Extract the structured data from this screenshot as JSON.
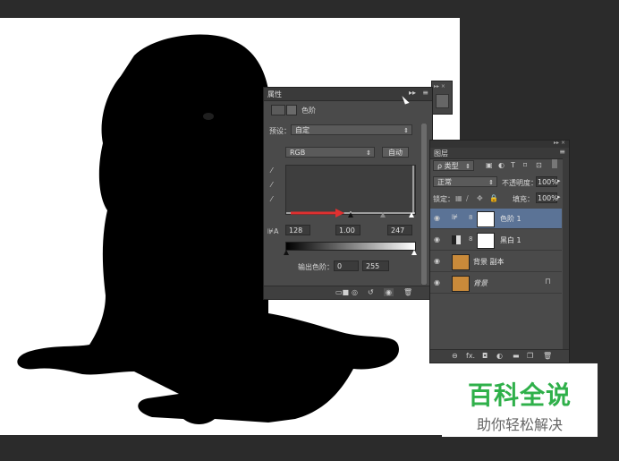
{
  "properties": {
    "tab": "属性",
    "title": "色阶",
    "preset_label": "预设：",
    "preset_value": "自定",
    "channel_value": "RGB",
    "auto_button": "自动",
    "input_black": "128",
    "input_gamma": "1.00",
    "input_white": "247",
    "output_label": "输出色阶：",
    "output_black": "0",
    "output_white": "255",
    "accent": "#e03030"
  },
  "layers": {
    "tab": "图层",
    "filter_label": "ρ 类型",
    "blend_mode": "正常",
    "opacity_label": "不透明度：",
    "opacity_value": "100%",
    "lock_label": "锁定：",
    "fill_label": "填充：",
    "fill_value": "100%",
    "items": [
      {
        "name": "色阶 1"
      },
      {
        "name": "黑白 1"
      },
      {
        "name": "背景 副本"
      },
      {
        "name": "背景"
      }
    ],
    "footer_fx": "fx."
  },
  "watermark": {
    "title": "百科全说",
    "subtitle": "助你轻松解决",
    "color": "#2fb04a"
  }
}
